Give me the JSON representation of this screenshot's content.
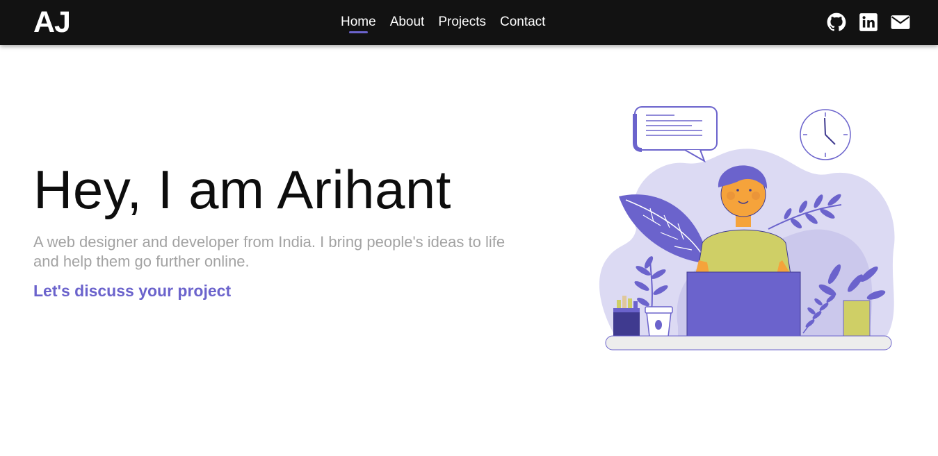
{
  "navbar": {
    "logo": "AJ",
    "links": [
      {
        "label": "Home",
        "active": true
      },
      {
        "label": "About",
        "active": false
      },
      {
        "label": "Projects",
        "active": false
      },
      {
        "label": "Contact",
        "active": false
      }
    ],
    "social_icons": [
      "github-icon",
      "linkedin-icon",
      "email-icon"
    ]
  },
  "hero": {
    "title": "Hey, I am Arihant",
    "subtitle": "A web designer and developer from India. I bring people's ideas to life and help them go further online.",
    "cta": "Let's discuss your project"
  },
  "colors": {
    "navbar_bg": "#121212",
    "accent": "#6b63cc",
    "subtitle_text": "#a3a3a3",
    "title_text": "#0d0d0d",
    "blob": "#dcdaf3",
    "shirt": "#cfcf66",
    "skin": "#f5a33b"
  }
}
